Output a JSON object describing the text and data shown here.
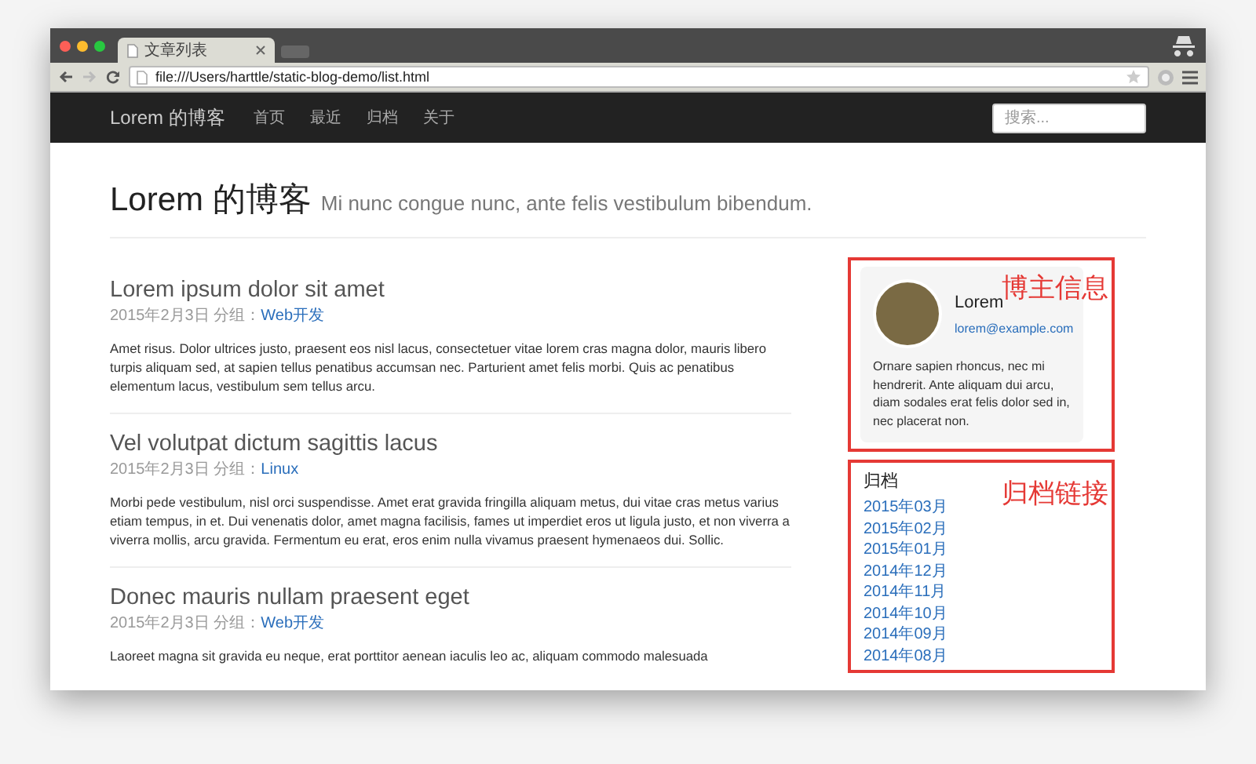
{
  "browser": {
    "tab_title": "文章列表",
    "url": "file:///Users/harttle/static-blog-demo/list.html"
  },
  "navbar": {
    "brand": "Lorem 的博客",
    "links": [
      "首页",
      "最近",
      "归档",
      "关于"
    ],
    "search": {
      "placeholder": "搜索..."
    }
  },
  "header": {
    "title": "Lorem 的博客",
    "subtitle": "Mi nunc congue nunc, ante felis vestibulum bibendum."
  },
  "posts": [
    {
      "title": "Lorem ipsum dolor sit amet",
      "meta": "2015年2月3日 分组：",
      "category": "Web开发",
      "body": "Amet risus. Dolor ultrices justo, praesent eos nisl lacus, consectetuer vitae lorem cras magna dolor, mauris libero turpis aliquam sed, at sapien tellus penatibus accumsan nec. Parturient amet felis morbi. Quis ac penatibus elementum lacus, vestibulum sem tellus arcu."
    },
    {
      "title": "Vel volutpat dictum sagittis lacus",
      "meta": "2015年2月3日 分组：",
      "category": "Linux",
      "body": "Morbi pede vestibulum, nisl orci suspendisse. Amet erat gravida fringilla aliquam metus, dui vitae cras metus varius etiam tempus, in et. Dui venenatis dolor, amet magna facilisis, fames ut imperdiet eros ut ligula justo, et non viverra a viverra mollis, arcu gravida. Fermentum eu erat, eros enim nulla vivamus praesent hymenaeos dui. Sollic."
    },
    {
      "title": "Donec mauris nullam praesent eget",
      "meta": "2015年2月3日 分组：",
      "category": "Web开发",
      "body": "Laoreet magna sit gravida eu neque, erat porttitor aenean iaculis leo ac, aliquam commodo malesuada"
    }
  ],
  "sidebar": {
    "profile": {
      "annotation": "博主信息",
      "name": "Lorem",
      "email": "lorem@example.com",
      "bio": "Ornare sapien rhoncus, nec mi hendrerit. Ante aliquam dui arcu, diam sodales erat felis dolor sed in, nec placerat non."
    },
    "archive": {
      "annotation": "归档链接",
      "heading": "归档",
      "links": [
        "2015年03月",
        "2015年02月",
        "2015年01月",
        "2014年12月",
        "2014年11月",
        "2014年10月",
        "2014年09月",
        "2014年08月"
      ]
    }
  }
}
